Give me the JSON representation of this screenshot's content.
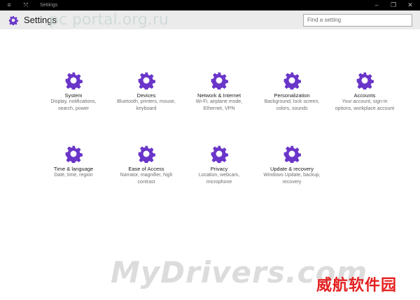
{
  "window": {
    "title": "Settings",
    "minimize_glyph": "–",
    "maximize_glyph": "❐",
    "close_glyph": "✕",
    "menu_glyph": "≡",
    "resize_glyph": "⤧"
  },
  "header": {
    "title": "Settings",
    "watermark": "pc portal.org.ru"
  },
  "search": {
    "placeholder": "Find a setting"
  },
  "accent_color": "#6a35c9",
  "categories": [
    {
      "name": "System",
      "description": "Display, notifications, search, power",
      "icon": "gear-icon"
    },
    {
      "name": "Devices",
      "description": "Bluetooth, printers, mouse, keyboard",
      "icon": "gear-icon"
    },
    {
      "name": "Network & Internet",
      "description": "Wi-Fi, airplane mode, Ethernet, VPN",
      "icon": "gear-icon"
    },
    {
      "name": "Personalization",
      "description": "Background, lock screen, colors, sounds",
      "icon": "gear-icon"
    },
    {
      "name": "Accounts",
      "description": "Your account, sign-in options, workplace account",
      "icon": "gear-icon"
    },
    {
      "name": "Time & language",
      "description": "Date, time, region",
      "icon": "gear-icon"
    },
    {
      "name": "Ease of Access",
      "description": "Narrator, magnifier, high contrast",
      "icon": "gear-icon"
    },
    {
      "name": "Privacy",
      "description": "Location, webcam, microphone",
      "icon": "gear-icon"
    },
    {
      "name": "Update & recovery",
      "description": "Windows Update, backup, recovery",
      "icon": "gear-icon"
    }
  ],
  "watermarks": {
    "bottom": "MyDrivers.com",
    "chinese": "威航软件园"
  }
}
